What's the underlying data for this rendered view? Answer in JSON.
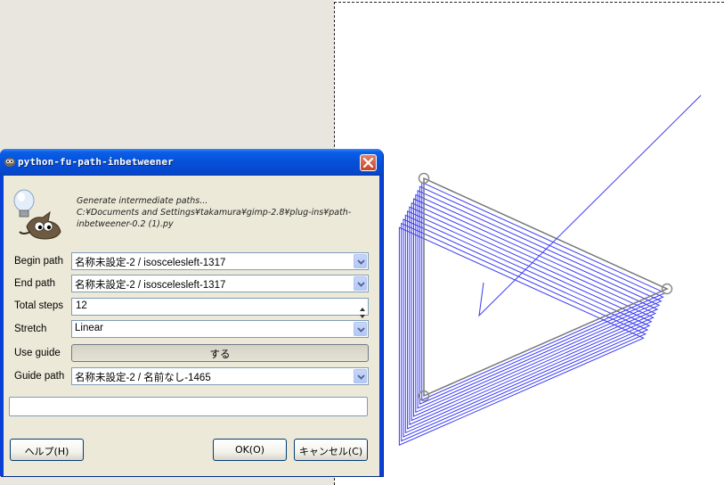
{
  "dialog": {
    "title": "python-fu-path-inbetweener",
    "description_lines": [
      "Generate intermediate paths...",
      "C:¥Documents and Settings¥takamura¥gimp-2.8¥plug-ins¥path-",
      "inbetweener-0.2 (1).py"
    ],
    "fields": {
      "begin_path": {
        "label": "Begin path",
        "value": "名称未設定-2 / isoscelesleft-1317"
      },
      "end_path": {
        "label": "End path",
        "value": "名称未設定-2 / isoscelesleft-1317"
      },
      "total_steps": {
        "label": "Total steps",
        "value": "12"
      },
      "stretch": {
        "label": "Stretch",
        "value": "Linear"
      },
      "use_guide": {
        "label": "Use guide",
        "value": "する"
      },
      "guide_path": {
        "label": "Guide path",
        "value": "名称未設定-2 / 名前なし-1465"
      }
    },
    "progress_text": "",
    "buttons": {
      "help": "ヘルプ(H)",
      "ok": "OK(O)",
      "cancel": "キャンセル(C)"
    }
  },
  "colors": {
    "titlebar": "#0550d8",
    "dialog_bg": "#ece9d8",
    "path_stroke": "#3333ee",
    "workspace_bg": "#e8e6de",
    "canvas_bg": "#ffffff"
  },
  "icons": [
    "gimp-icon",
    "close-icon",
    "lightbulb-icon",
    "wilber-mascot-icon",
    "dropdown-arrow-icon",
    "spin-up-icon",
    "spin-down-icon"
  ]
}
